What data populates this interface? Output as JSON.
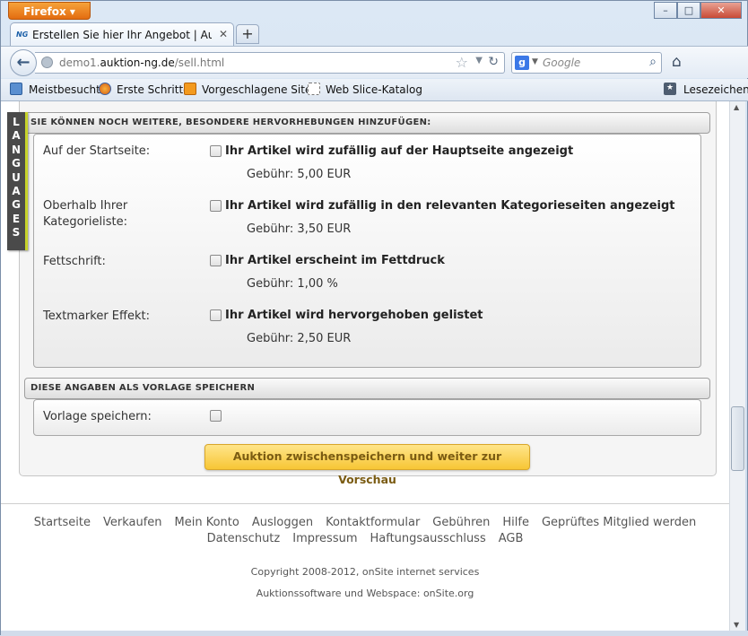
{
  "browser": {
    "app_button": "Firefox",
    "window_controls": [
      "–",
      "□",
      "✕"
    ],
    "tab": {
      "title": "Erstellen Sie hier Ihr Angebot | Auktion:N...",
      "favicon": "NG"
    },
    "url_prefix": "demo1.",
    "url_domain": "auktion-ng.de",
    "url_path": "/sell.html",
    "search_placeholder": "Google",
    "bookmarks": [
      "Meistbesucht",
      "Erste Schritte",
      "Vorgeschlagene Sites",
      "Web Slice-Katalog"
    ],
    "bookmarks_right": "Lesezeichen"
  },
  "languages_tab": [
    "L",
    "A",
    "N",
    "G",
    "U",
    "A",
    "G",
    "E",
    "S"
  ],
  "section1": {
    "header": "SIE KÖNNEN NOCH WEITERE, BESONDERE HERVORHEBUNGEN HINZUFÜGEN:",
    "rows": [
      {
        "label": "Auf der Startseite:",
        "option": "Ihr Artikel wird zufällig auf der Hauptseite angezeigt",
        "fee": "Gebühr: 5,00 EUR",
        "checked": false
      },
      {
        "label": "Oberhalb Ihrer Kategorieliste:",
        "option": "Ihr Artikel wird zufällig in den relevanten Kategorieseiten angezeigt",
        "fee": "Gebühr: 3,50 EUR",
        "checked": false
      },
      {
        "label": "Fettschrift:",
        "option": "Ihr Artikel erscheint im Fettdruck",
        "fee": "Gebühr: 1,00 %",
        "checked": false
      },
      {
        "label": "Textmarker Effekt:",
        "option": "Ihr Artikel wird hervorgehoben gelistet",
        "fee": "Gebühr: 2,50 EUR",
        "checked": false
      }
    ]
  },
  "section2": {
    "header": "DIESE ANGABEN ALS VORLAGE SPEICHERN",
    "label": "Vorlage speichern:",
    "checked": false
  },
  "submit_button": "Auktion zwischenspeichern und weiter zur Vorschau",
  "footer": {
    "links_row1": [
      "Startseite",
      "Verkaufen",
      "Mein Konto",
      "Ausloggen",
      "Kontaktformular",
      "Gebühren",
      "Hilfe",
      "Geprüftes Mitglied werden"
    ],
    "links_row2": [
      "Datenschutz",
      "Impressum",
      "Haftungsausschluss",
      "AGB"
    ],
    "copyright": "Copyright 2008-2012, onSite internet services",
    "software": "Auktionssoftware und Webspace: onSite.org"
  },
  "colors": {
    "accent_button": "#f7c635",
    "firefox_orange": "#e36c10",
    "languages_stripe": "#c7d32a"
  }
}
